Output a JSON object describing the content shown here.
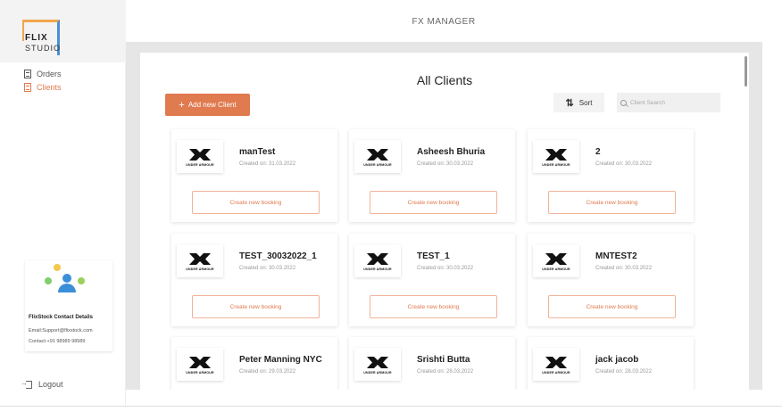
{
  "app": {
    "title": "FX MANAGER"
  },
  "logo": {
    "line1": "FLIX",
    "line2": "STUDIO"
  },
  "sidebar": {
    "items": [
      {
        "label": "Orders",
        "active": false
      },
      {
        "label": "Clients",
        "active": true
      }
    ],
    "logout_label": "Logout"
  },
  "contact": {
    "title": "FlixStock Contact Details",
    "email": "Email:Support@flixstock.com",
    "phone": "Contact:+91 98989 98989"
  },
  "main": {
    "title": "All Clients",
    "add_button_label": "Add new Client",
    "sort_label": "Sort",
    "search_placeholder": "Client Search"
  },
  "colors": {
    "accent": "#e07a4f",
    "background": "#e6e6e6"
  },
  "brand": {
    "logo_text": "UNDER ARMOUR",
    "icon": "under-armour-logo"
  },
  "book_button_label": "Create new booking",
  "clients": [
    {
      "name": "manTest",
      "created": "Created on: 31.03.2022"
    },
    {
      "name": "Asheesh Bhuria",
      "created": "Created on: 30.03.2022"
    },
    {
      "name": "2",
      "created": "Created on: 30.03.2022"
    },
    {
      "name": "TEST_30032022_1",
      "created": "Created on: 30.03.2022"
    },
    {
      "name": "TEST_1",
      "created": "Created on: 30.03.2022"
    },
    {
      "name": "MNTEST2",
      "created": "Created on: 30.03.2022"
    },
    {
      "name": "Peter Manning NYC",
      "created": "Created on: 29.03.2022"
    },
    {
      "name": "Srishti Butta",
      "created": "Created on: 28.03.2022"
    },
    {
      "name": "jack jacob",
      "created": "Created on: 28.03.2022"
    }
  ]
}
